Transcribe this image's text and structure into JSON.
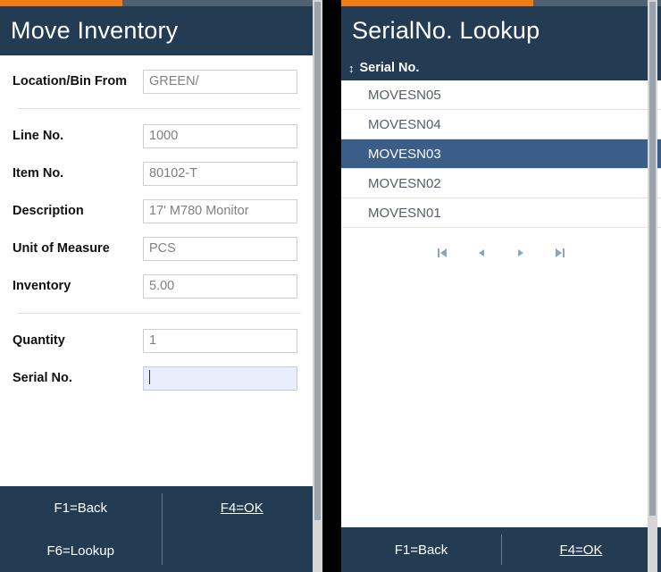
{
  "theme": {
    "accent_orange": "#f07c12",
    "header_navy": "#243b54",
    "selected_row_blue": "#3a5e88",
    "focus_field_blue": "#e8eefb"
  },
  "left_panel": {
    "title": "Move Inventory",
    "fields": [
      {
        "label": "Location/Bin From",
        "value": "GREEN/",
        "focused": false
      },
      {
        "label": "Line No.",
        "value": "1000",
        "focused": false
      },
      {
        "label": "Item No.",
        "value": "80102-T",
        "focused": false
      },
      {
        "label": "Description",
        "value": "17' M780 Monitor",
        "focused": false
      },
      {
        "label": "Unit of Measure",
        "value": "PCS",
        "focused": false
      },
      {
        "label": "Inventory",
        "value": "5.00",
        "focused": false
      },
      {
        "label": "Quantity",
        "value": "1",
        "focused": false
      },
      {
        "label": "Serial No.",
        "value": "",
        "focused": true
      }
    ],
    "footer": {
      "back": "F1=Back",
      "ok": "F4=OK",
      "lookup": "F6=Lookup"
    }
  },
  "right_panel": {
    "title": "SerialNo. Lookup",
    "column_header": "Serial No.",
    "sort_icon": "sort-updown-icon",
    "rows": [
      {
        "serial_no": "MOVESN05",
        "selected": false
      },
      {
        "serial_no": "MOVESN04",
        "selected": false
      },
      {
        "serial_no": "MOVESN03",
        "selected": true
      },
      {
        "serial_no": "MOVESN02",
        "selected": false
      },
      {
        "serial_no": "MOVESN01",
        "selected": false
      }
    ],
    "pager": [
      {
        "name": "first-page-button",
        "icon": "first-page-icon"
      },
      {
        "name": "previous-page-button",
        "icon": "previous-page-icon"
      },
      {
        "name": "next-page-button",
        "icon": "next-page-icon"
      },
      {
        "name": "last-page-button",
        "icon": "last-page-icon"
      }
    ],
    "footer": {
      "back": "F1=Back",
      "ok": "F4=OK"
    }
  }
}
